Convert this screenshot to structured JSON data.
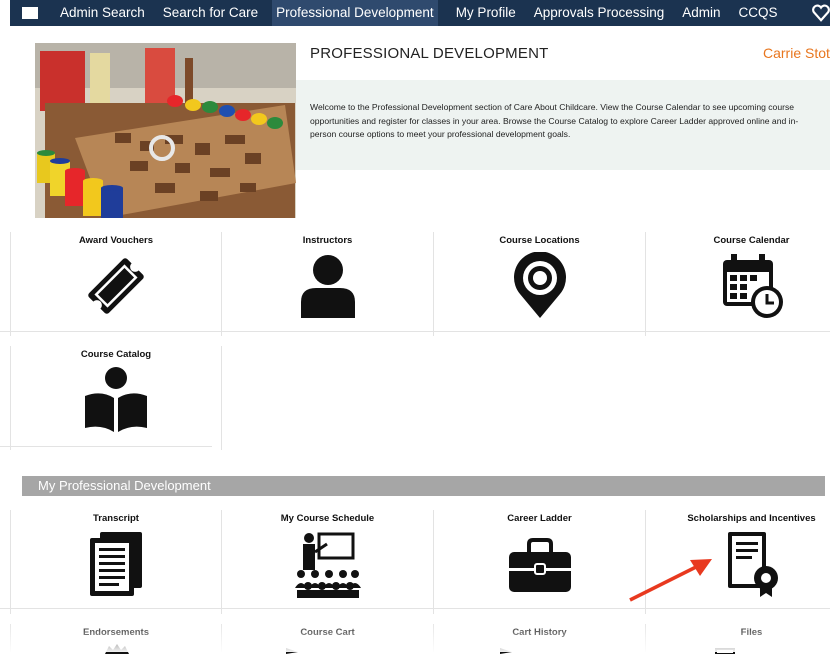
{
  "nav": {
    "items": [
      "Admin Search",
      "Search for Care",
      "Professional Development",
      "My Profile",
      "Approvals Processing",
      "Admin",
      "CCQS"
    ],
    "active_index": 2
  },
  "header": {
    "title": "PROFESSIONAL DEVELOPMENT",
    "user_name": "Carrie Stot",
    "welcome": "Welcome to the Professional Development section of Care About Childcare. View the Course Calendar to see upcoming course opportunities and register for classes in your area. Browse the Course Catalog to explore Career Ladder approved online and in-person course options to meet your professional development goals."
  },
  "tiles_top": [
    {
      "label": "Award Vouchers",
      "icon": "ticket-icon"
    },
    {
      "label": "Instructors",
      "icon": "person-icon"
    },
    {
      "label": "Course Locations",
      "icon": "map-pin-icon"
    },
    {
      "label": "Course Calendar",
      "icon": "calendar-clock-icon"
    },
    {
      "label": "Course Catalog",
      "icon": "reader-book-icon"
    }
  ],
  "section": {
    "title": "My Professional Development"
  },
  "tiles_my": [
    {
      "label": "Transcript",
      "icon": "document-icon"
    },
    {
      "label": "My Course Schedule",
      "icon": "classroom-icon"
    },
    {
      "label": "Career Ladder",
      "icon": "briefcase-icon"
    },
    {
      "label": "Scholarships and Incentives",
      "icon": "certificate-icon"
    },
    {
      "label": "Endorsements",
      "icon": "badge-icon"
    },
    {
      "label": "Course Cart",
      "icon": "cart-icon"
    },
    {
      "label": "Cart History",
      "icon": "history-icon"
    },
    {
      "label": "Files",
      "icon": "file-icon"
    }
  ],
  "colors": {
    "nav_bg": "#1b3350",
    "accent": "#e8761e",
    "section_bar": "#a6a6a6",
    "arrow": "#e8391f"
  }
}
